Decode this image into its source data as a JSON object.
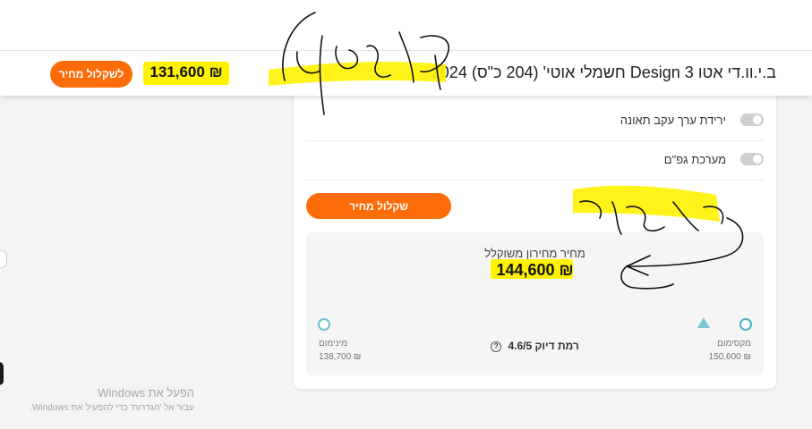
{
  "header": {
    "car_title": "ב.י.וו.די אטו 3 Design חשמלי אוטי' (204 כ\"ס) 2024",
    "top_price": "₪ 131,600",
    "cta": "לשקלול מחיר"
  },
  "options": [
    {
      "label": "ירידת ערך עקב תאונה"
    },
    {
      "label": "מערכת גפ\"ם"
    }
  ],
  "calc_button": "שקלול מחיר",
  "price_panel": {
    "label": "מחיר מחירון משוקלל",
    "value": "₪ 144,600",
    "max_label": "מקסימום",
    "max_value": "₪ 150,600",
    "min_label": "מינימום",
    "min_value": "₪ 138,700",
    "accuracy": "רמת דיוק 4.6/5",
    "range_position": 0.9
  },
  "windows_watermark": {
    "title": "הפעל את Windows",
    "subtitle": "עבור אל 'הגדרות' כדי להפעיל את Windows."
  },
  "colors": {
    "accent": "#ff6d0a",
    "highlight": "#fff200",
    "range": "#48b6c3"
  }
}
